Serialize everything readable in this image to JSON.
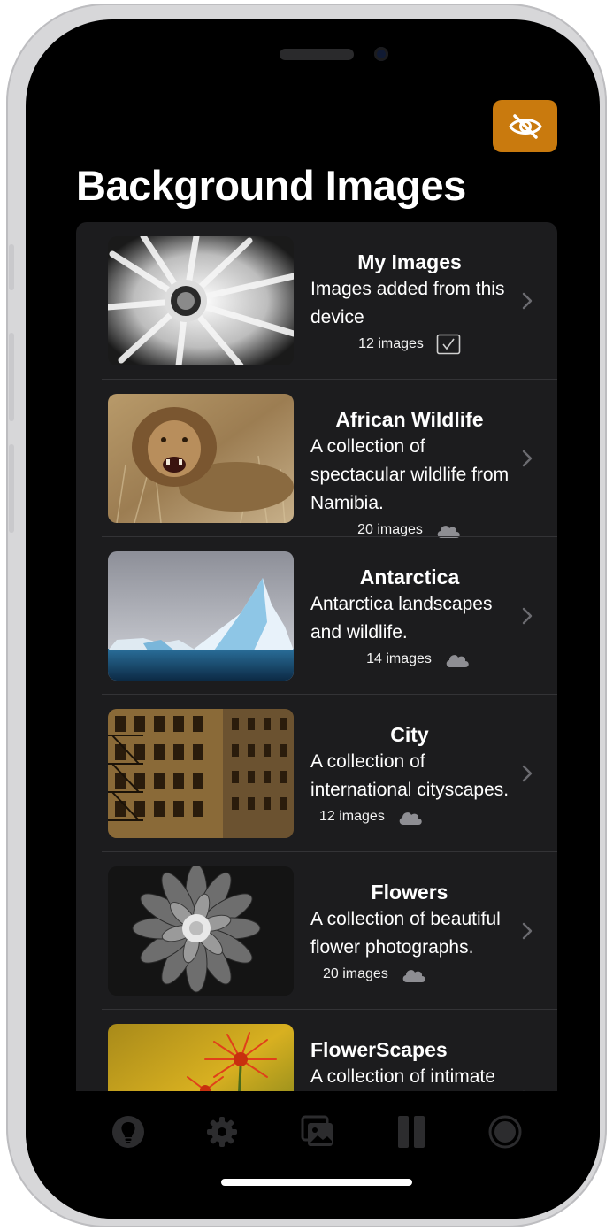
{
  "page": {
    "title": "Background Images"
  },
  "header": {
    "hide_button_icon": "eye-slash-icon"
  },
  "collections": [
    {
      "name": "My Images",
      "description": "Images added from this device",
      "count": "12 images",
      "status_icon": "checkbox-checked-icon"
    },
    {
      "name": "African Wildlife",
      "description": "A collection of spectacular wildlife from Namibia.",
      "count": "20 images",
      "status_icon": "cloud-icon"
    },
    {
      "name": "Antarctica",
      "description": "Antarctica landscapes and wildlife.",
      "count": "14 images",
      "status_icon": "cloud-icon"
    },
    {
      "name": "City",
      "description": "A collection of international cityscapes.",
      "count": "12 images",
      "status_icon": "cloud-icon"
    },
    {
      "name": "Flowers",
      "description": "A collection of beautiful flower photographs.",
      "count": "20 images",
      "status_icon": "cloud-icon"
    },
    {
      "name": "FlowerScapes",
      "description": "A collection of intimate flower",
      "count": "",
      "status_icon": "cloud-icon"
    }
  ],
  "tabbar": {
    "items": [
      {
        "icon": "lightbulb-icon"
      },
      {
        "icon": "gear-icon"
      },
      {
        "icon": "photo-stack-icon"
      },
      {
        "icon": "pause-icon"
      },
      {
        "icon": "circle-target-icon"
      }
    ]
  },
  "colors": {
    "accent": "#c97a0e",
    "list_bg": "#1c1c1e",
    "background": "#000000"
  }
}
